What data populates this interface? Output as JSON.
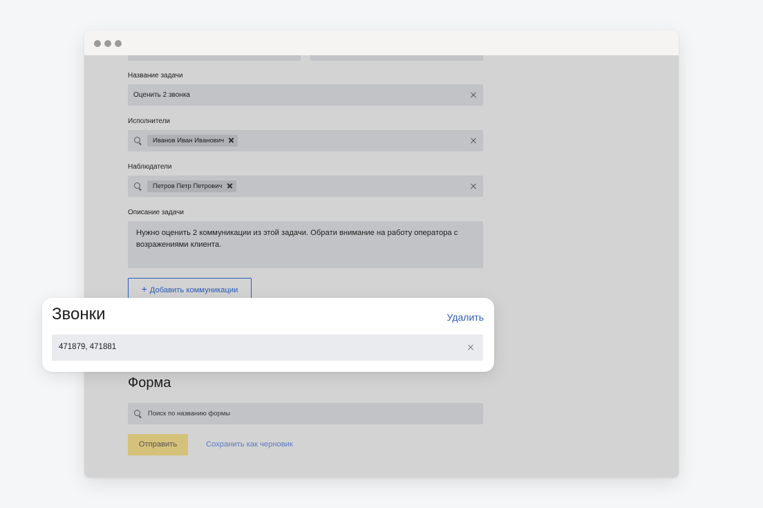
{
  "window": {
    "buttons": [
      "close",
      "minimize",
      "maximize"
    ]
  },
  "form": {
    "task_title_label": "Название задачи",
    "task_title_value": "Оценить 2 звонка",
    "assignees_label": "Исполнители",
    "assignees": [
      "Иванов Иван Иванович"
    ],
    "observers_label": "Наблюдатели",
    "observers": [
      "Петров Петр Петрович"
    ],
    "description_label": "Описание задачи",
    "description_value": "Нужно оценить 2 коммуникации из этой задачи. Обрати внимание на работу оператора с возражениями клиента.",
    "add_communications_label": "Добавить коммуникации",
    "form_section_title": "Форма",
    "form_search_placeholder": "Поиск по названию формы",
    "submit_label": "Отправить",
    "save_draft_label": "Сохранить как черновик"
  },
  "calls_card": {
    "title": "Звонки",
    "delete_label": "Удалить",
    "value": "471879, 471881"
  },
  "colors": {
    "accent": "#2c5ab8",
    "submit_button": "#d4c27a",
    "overlay_background": "#d3d3d3"
  }
}
